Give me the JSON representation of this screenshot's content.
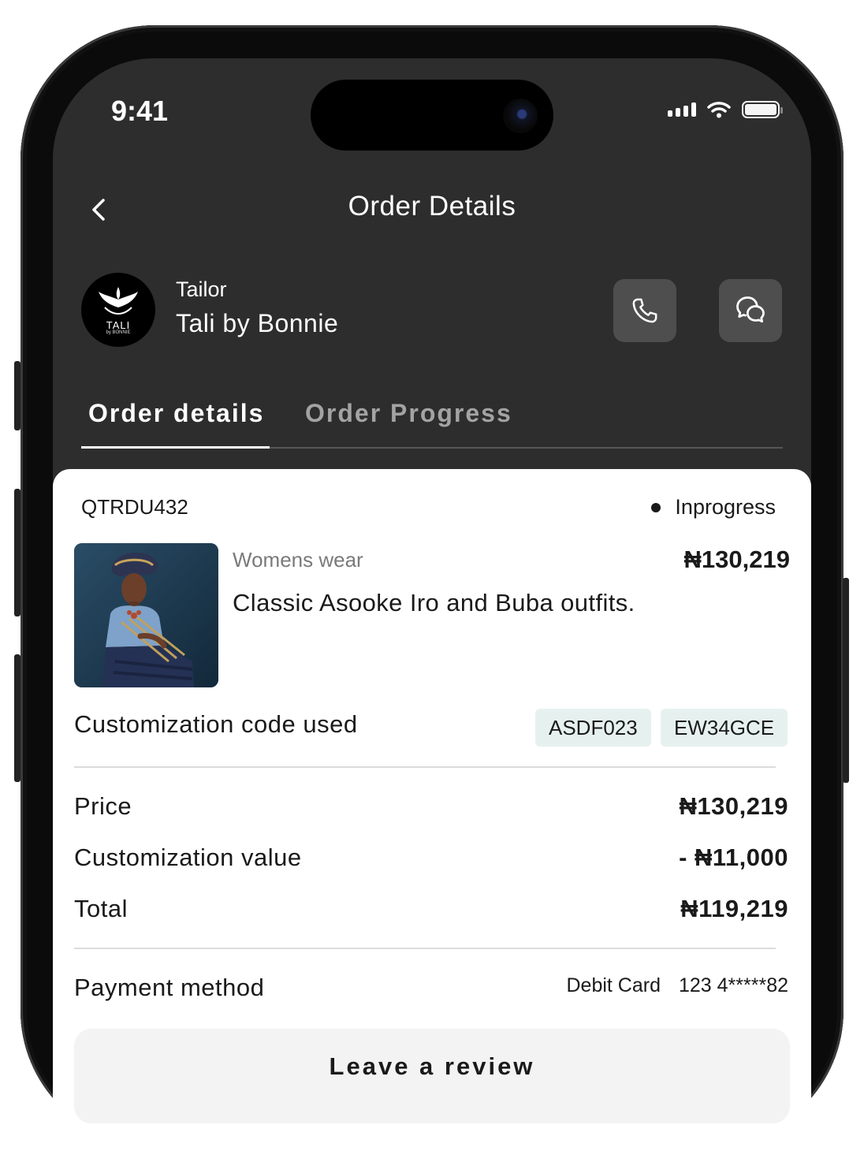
{
  "status_bar": {
    "time": "9:41"
  },
  "header": {
    "title": "Order Details"
  },
  "vendor": {
    "role": "Tailor",
    "name": "Tali by Bonnie",
    "logo_text": "TALI",
    "logo_subtext": "by BONNIE"
  },
  "tabs": [
    {
      "label": "Order details",
      "active": true
    },
    {
      "label": "Order Progress",
      "active": false
    }
  ],
  "order": {
    "code": "QTRDU432",
    "status": "Inprogress",
    "category": "Womens wear",
    "price": "₦130,219",
    "product_name": "Classic Asooke Iro and Buba outfits."
  },
  "customization": {
    "label": "Customization code used",
    "codes": [
      "ASDF023",
      "EW34GCE"
    ]
  },
  "summary": {
    "price_label": "Price",
    "price_value": "₦130,219",
    "customization_label": "Customization value",
    "customization_value": "- ₦11,000",
    "total_label": "Total",
    "total_value": "₦119,219"
  },
  "payment": {
    "label": "Payment method",
    "type": "Debit Card",
    "number": "123 4*****82"
  },
  "actions": {
    "review_label": "Leave a review"
  },
  "colors": {
    "screen_bg": "#2d2d2d",
    "chip_bg": "#e6f1ef",
    "card_bg": "#ffffff",
    "button_bg": "#4e4e4e"
  }
}
